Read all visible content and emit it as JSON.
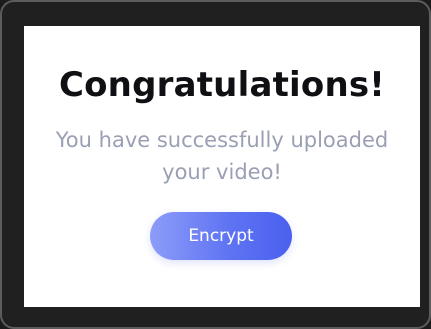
{
  "dialog": {
    "title": "Congratulations!",
    "message": "You have successfully uploaded your video!",
    "button_label": "Encrypt"
  },
  "colors": {
    "title": "#0f0f14",
    "message": "#9a9fb3",
    "button_start": "#8d9cf9",
    "button_end": "#4a60ef",
    "frame": "#202020"
  }
}
